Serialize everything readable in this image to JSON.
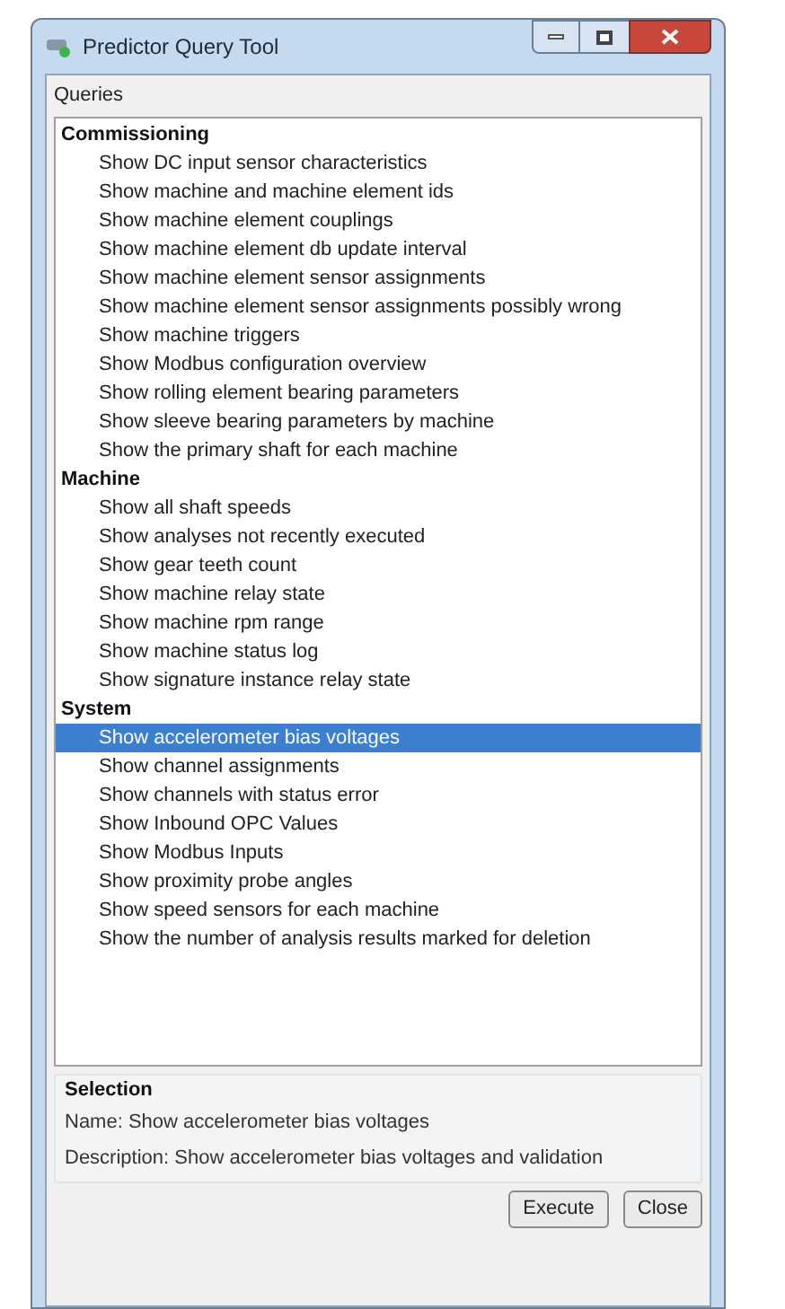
{
  "window": {
    "title": "Predictor Query Tool"
  },
  "queries_label": "Queries",
  "groups": [
    {
      "name": "Commissioning",
      "items": [
        {
          "label": "Show DC input sensor characteristics",
          "selected": false
        },
        {
          "label": "Show machine and machine element ids",
          "selected": false
        },
        {
          "label": "Show machine element couplings",
          "selected": false
        },
        {
          "label": "Show machine element db update interval",
          "selected": false
        },
        {
          "label": "Show machine element sensor assignments",
          "selected": false
        },
        {
          "label": "Show machine element sensor assignments possibly wrong",
          "selected": false
        },
        {
          "label": "Show machine triggers",
          "selected": false
        },
        {
          "label": "Show Modbus configuration overview",
          "selected": false
        },
        {
          "label": "Show rolling element bearing parameters",
          "selected": false
        },
        {
          "label": "Show sleeve bearing parameters by machine",
          "selected": false
        },
        {
          "label": "Show the primary shaft for each machine",
          "selected": false
        }
      ]
    },
    {
      "name": "Machine",
      "items": [
        {
          "label": "Show all shaft speeds",
          "selected": false
        },
        {
          "label": "Show analyses not recently executed",
          "selected": false
        },
        {
          "label": "Show gear teeth count",
          "selected": false
        },
        {
          "label": "Show machine relay state",
          "selected": false
        },
        {
          "label": "Show machine rpm range",
          "selected": false
        },
        {
          "label": "Show machine status log",
          "selected": false
        },
        {
          "label": "Show signature instance relay state",
          "selected": false
        }
      ]
    },
    {
      "name": "System",
      "items": [
        {
          "label": "Show accelerometer bias voltages",
          "selected": true
        },
        {
          "label": "Show channel assignments",
          "selected": false
        },
        {
          "label": "Show channels with status error",
          "selected": false
        },
        {
          "label": "Show Inbound OPC Values",
          "selected": false
        },
        {
          "label": "Show Modbus Inputs",
          "selected": false
        },
        {
          "label": "Show proximity probe angles",
          "selected": false
        },
        {
          "label": "Show speed sensors for each machine",
          "selected": false
        },
        {
          "label": "Show the number of analysis results marked for deletion",
          "selected": false
        }
      ]
    }
  ],
  "selection": {
    "title": "Selection",
    "name": "Name: Show accelerometer bias voltages",
    "description": "Description: Show accelerometer bias voltages and validation"
  },
  "buttons": [
    "Execute",
    "Close"
  ]
}
